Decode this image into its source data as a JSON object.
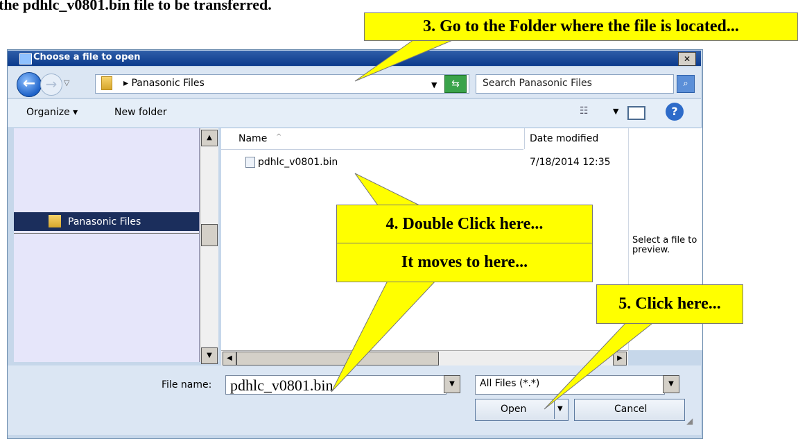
{
  "top_caption": "the pdhlc_v0801.bin file to be transferred.",
  "callouts": {
    "step3": "3. Go to the Folder where the file is located...",
    "step4": "4. Double Click here...",
    "step4b": "It moves to here...",
    "step5": "5. Click here..."
  },
  "dialog": {
    "title": "Choose a file to open",
    "close_glyph": "✕",
    "address": {
      "path": "▸ Panasonic Files",
      "search_placeholder": "Search Panasonic Files"
    },
    "toolbar": {
      "organize": "Organize ▾",
      "new_folder": "New folder"
    },
    "nav": {
      "selected_item": "Panasonic Files"
    },
    "list": {
      "col_name": "Name",
      "col_date": "Date modified",
      "files": [
        {
          "name": "pdhlc_v0801.bin",
          "date": "7/18/2014 12:35"
        }
      ]
    },
    "preview_text": "Select a file to preview.",
    "file_name_label": "File name:",
    "file_name_value": "pdhlc_v0801.bin",
    "file_type": "All Files (*.*)",
    "open_label": "Open",
    "cancel_label": "Cancel"
  }
}
